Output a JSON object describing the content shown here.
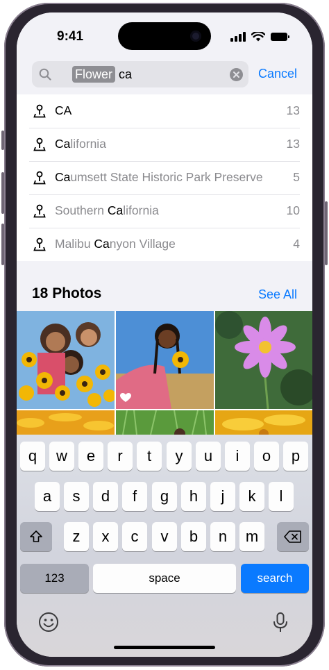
{
  "status_bar": {
    "time": "9:41"
  },
  "search": {
    "token": "Flower",
    "query": "ca",
    "cancel_label": "Cancel"
  },
  "suggestions": [
    {
      "pre": "",
      "match": "CA",
      "post": "",
      "count": "13"
    },
    {
      "pre": "",
      "match": "Ca",
      "post": "lifornia",
      "count": "13"
    },
    {
      "pre": "",
      "match": "Ca",
      "post": "umsett State Historic Park Preserve",
      "count": "5"
    },
    {
      "pre": "Southern ",
      "match": "Ca",
      "post": "lifornia",
      "count": "10"
    },
    {
      "pre": "Malibu ",
      "match": "Ca",
      "post": "nyon Village",
      "count": "4"
    }
  ],
  "photos": {
    "title": "18 Photos",
    "see_all_label": "See All"
  },
  "keyboard": {
    "row1": [
      "q",
      "w",
      "e",
      "r",
      "t",
      "y",
      "u",
      "i",
      "o",
      "p"
    ],
    "row2": [
      "a",
      "s",
      "d",
      "f",
      "g",
      "h",
      "j",
      "k",
      "l"
    ],
    "row3": [
      "z",
      "x",
      "c",
      "v",
      "b",
      "n",
      "m"
    ],
    "numbers_label": "123",
    "space_label": "space",
    "return_label": "search"
  },
  "colors": {
    "accent": "#0a7aff",
    "background": "#f2f2f7"
  }
}
